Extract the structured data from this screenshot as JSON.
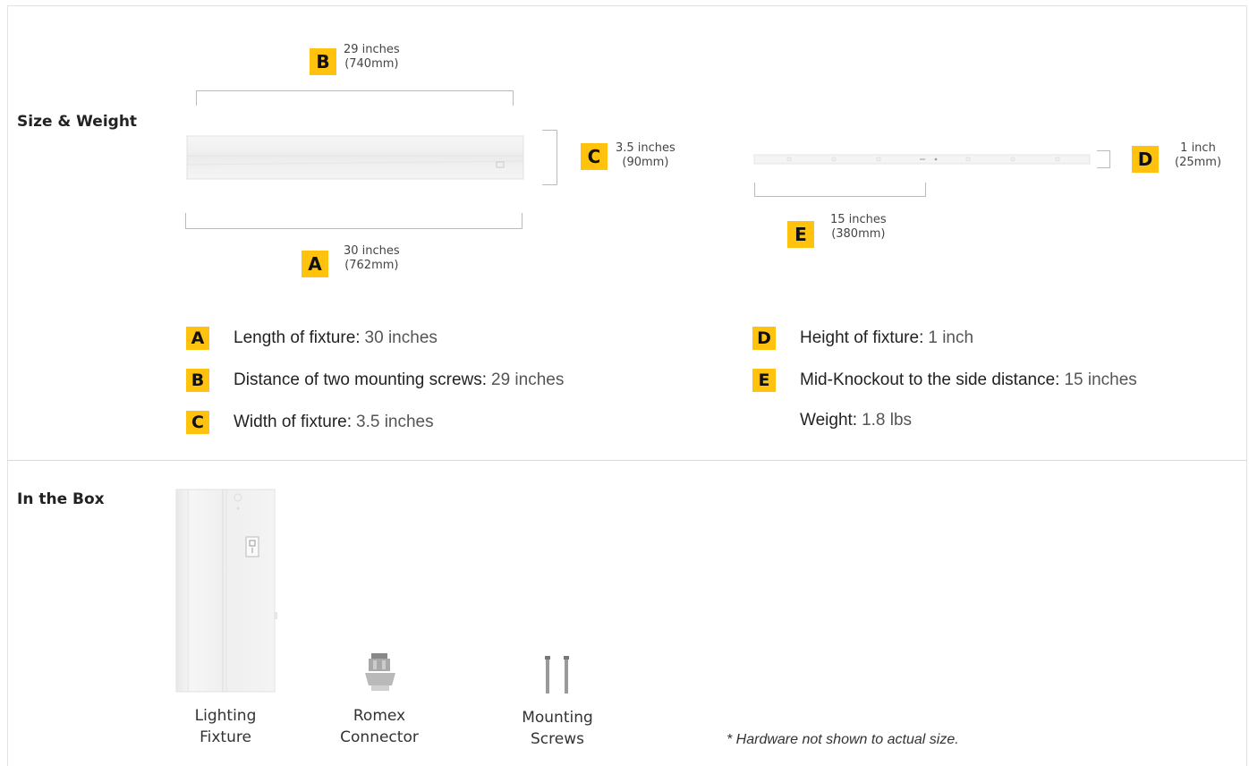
{
  "size_weight": {
    "title": "Size & Weight",
    "dims": {
      "b": {
        "letter": "B",
        "line1": "29 inches",
        "line2": "(740mm)"
      },
      "c": {
        "letter": "C",
        "line1": "3.5 inches",
        "line2": "(90mm)"
      },
      "a": {
        "letter": "A",
        "line1": "30 inches",
        "line2": "(762mm)"
      },
      "d": {
        "letter": "D",
        "line1": "1 inch",
        "line2": "(25mm)"
      },
      "e": {
        "letter": "E",
        "line1": "15 inches",
        "line2": "(380mm)"
      }
    },
    "specs": [
      {
        "letter": "A",
        "label": "Length of fixture:",
        "value": "30 inches"
      },
      {
        "letter": "B",
        "label": "Distance of two mounting screws:",
        "value": "29 inches"
      },
      {
        "letter": "C",
        "label": "Width of fixture:",
        "value": "3.5 inches"
      },
      {
        "letter": "D",
        "label": "Height of fixture:",
        "value": "1 inch"
      },
      {
        "letter": "E",
        "label": "Mid-Knockout to the side distance:",
        "value": "15 inches"
      },
      {
        "letter": "",
        "label": "Weight:",
        "value": "1.8 lbs"
      }
    ]
  },
  "in_the_box": {
    "title": "In the Box",
    "items": [
      {
        "line1": "Lighting",
        "line2": "Fixture"
      },
      {
        "line1": "Romex",
        "line2": "Connector"
      },
      {
        "line1": "Mounting",
        "line2": "Screws"
      }
    ],
    "note": "* Hardware not shown to actual size."
  },
  "colors": {
    "badge": "#ffc20e",
    "divider": "#d9d9d9"
  }
}
